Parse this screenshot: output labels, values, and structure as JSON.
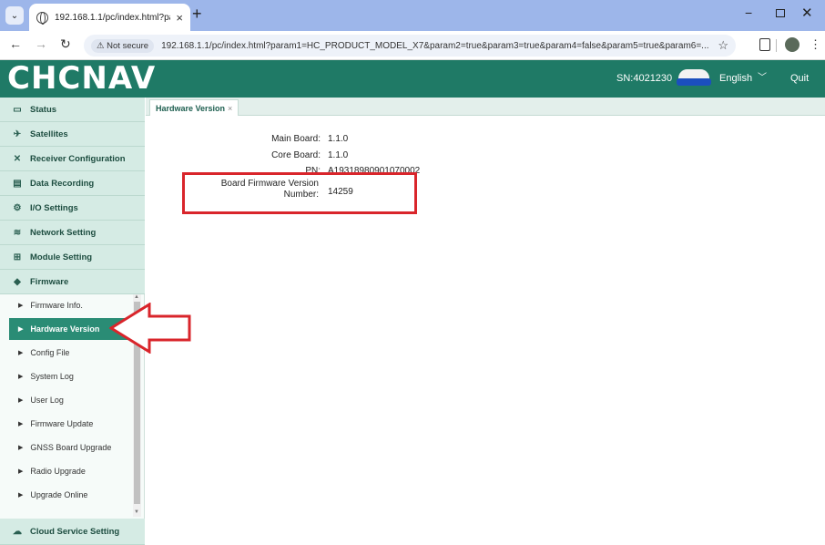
{
  "browser": {
    "tab_title": "192.168.1.1/pc/index.html?param",
    "new_tab": "+",
    "security_label": "⚠ Not secure",
    "url": "192.168.1.1/pc/index.html?param1=HC_PRODUCT_MODEL_X7&param2=true&param3=true&param4=false&param5=true&param6=..."
  },
  "header": {
    "logo_text": "CHCNAV",
    "serial": "SN:4021230",
    "language": "English",
    "quit_label": "Quit"
  },
  "sidebar": {
    "groups": [
      {
        "label": "Status",
        "icon": "monitor-icon",
        "glyph": "▭"
      },
      {
        "label": "Satellites",
        "icon": "satellite-icon",
        "glyph": "✈"
      },
      {
        "label": "Receiver Configuration",
        "icon": "tools-icon",
        "glyph": "✕"
      },
      {
        "label": "Data Recording",
        "icon": "document-icon",
        "glyph": "▤"
      },
      {
        "label": "I/O Settings",
        "icon": "gear-icon",
        "glyph": "⚙"
      },
      {
        "label": "Network Setting",
        "icon": "wifi-icon",
        "glyph": "≋"
      },
      {
        "label": "Module Setting",
        "icon": "grid-icon",
        "glyph": "⊞"
      },
      {
        "label": "Firmware",
        "icon": "layers-icon",
        "glyph": "◆"
      }
    ],
    "firmware_items": [
      {
        "label": "Firmware Info.",
        "active": false
      },
      {
        "label": "Hardware Version",
        "active": true
      },
      {
        "label": "Config File",
        "active": false
      },
      {
        "label": "System Log",
        "active": false
      },
      {
        "label": "User Log",
        "active": false
      },
      {
        "label": "Firmware Update",
        "active": false
      },
      {
        "label": "GNSS Board Upgrade",
        "active": false
      },
      {
        "label": "Radio Upgrade",
        "active": false
      },
      {
        "label": "Upgrade Online",
        "active": false
      }
    ],
    "bottom_group": {
      "label": "Cloud Service Setting",
      "icon": "cloud-icon",
      "glyph": "☁"
    }
  },
  "content": {
    "active_tab": "Hardware Version",
    "tab_close": "×",
    "fields": [
      {
        "label": "Main Board:",
        "value": "1.1.0"
      },
      {
        "label": "Core Board:",
        "value": "1.1.0"
      },
      {
        "label": "PN:",
        "value": "A19318980901070002"
      },
      {
        "label": "Board Firmware Version Number:",
        "value": "14259"
      }
    ]
  },
  "colors": {
    "header_bg": "#1f7a66",
    "active_item_bg": "#2a8c75",
    "highlight": "#d9252b"
  }
}
